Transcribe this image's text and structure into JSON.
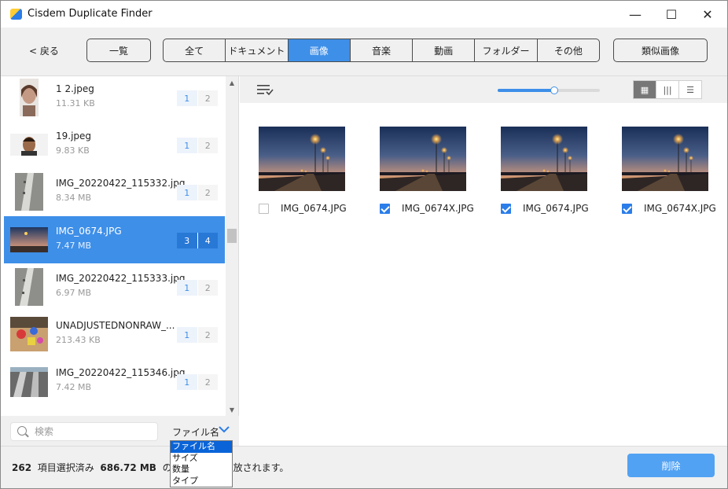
{
  "window": {
    "title": "Cisdem Duplicate Finder",
    "minimize": "—",
    "maximize": "☐",
    "close": "✕"
  },
  "toolbar": {
    "back_label": "< 戻る",
    "overview_label": "一覧",
    "similar_label": "類似画像",
    "tabs": [
      {
        "label": "全て",
        "active": false
      },
      {
        "label": "ドキュメント",
        "active": false
      },
      {
        "label": "画像",
        "active": true
      },
      {
        "label": "音楽",
        "active": false
      },
      {
        "label": "動画",
        "active": false
      },
      {
        "label": "フォルダー",
        "active": false
      },
      {
        "label": "その他",
        "active": false
      }
    ]
  },
  "file_list": {
    "items": [
      {
        "name": "1 2.jpeg",
        "size": "11.31 KB",
        "c1": "1",
        "c2": "2",
        "selected": false,
        "thumb": "portrait-woman"
      },
      {
        "name": "19.jpeg",
        "size": "9.83 KB",
        "c1": "1",
        "c2": "2",
        "selected": false,
        "thumb": "portrait-man"
      },
      {
        "name": "IMG_20220422_115332.jpg",
        "size": "8.34 MB",
        "c1": "1",
        "c2": "2",
        "selected": false,
        "thumb": "rail"
      },
      {
        "name": "IMG_0674.JPG",
        "size": "7.47 MB",
        "c1": "3",
        "c2": "4",
        "selected": true,
        "thumb": "dusk-road"
      },
      {
        "name": "IMG_20220422_115333.jpg",
        "size": "6.97 MB",
        "c1": "1",
        "c2": "2",
        "selected": false,
        "thumb": "rail"
      },
      {
        "name": "UNADJUSTEDNONRAW_...",
        "size": "213.43 KB",
        "c1": "1",
        "c2": "2",
        "selected": false,
        "thumb": "toys"
      },
      {
        "name": "IMG_20220422_115346.jpg",
        "size": "7.42 MB",
        "c1": "1",
        "c2": "2",
        "selected": false,
        "thumb": "rail-dark"
      }
    ]
  },
  "search": {
    "placeholder": "検索"
  },
  "sort": {
    "selected": "ファイル名",
    "options": [
      "ファイル名",
      "サイズ",
      "数量",
      "タイプ"
    ]
  },
  "preview": {
    "zoom_percent": 50,
    "view_modes": [
      {
        "icon": "grid-icon",
        "glyph": "▦",
        "active": true
      },
      {
        "icon": "filmstrip-icon",
        "glyph": "|||",
        "active": false
      },
      {
        "icon": "list-icon",
        "glyph": "☰",
        "active": false
      }
    ],
    "cards": [
      {
        "name": "IMG_0674.JPG",
        "checked": false
      },
      {
        "name": "IMG_0674X.JPG",
        "checked": true
      },
      {
        "name": "IMG_0674.JPG",
        "checked": true
      },
      {
        "name": "IMG_0674X.JPG",
        "checked": true
      }
    ]
  },
  "status": {
    "count": "262",
    "count_label": "項目選択済み",
    "size": "686.72 MB",
    "size_label_pre": "のスト",
    "size_label_post": "放されます。",
    "delete_label": "削除"
  },
  "colors": {
    "accent": "#3e8fe8",
    "delete_button": "#52a2f3",
    "dropdown_highlight": "#0a64d8"
  }
}
